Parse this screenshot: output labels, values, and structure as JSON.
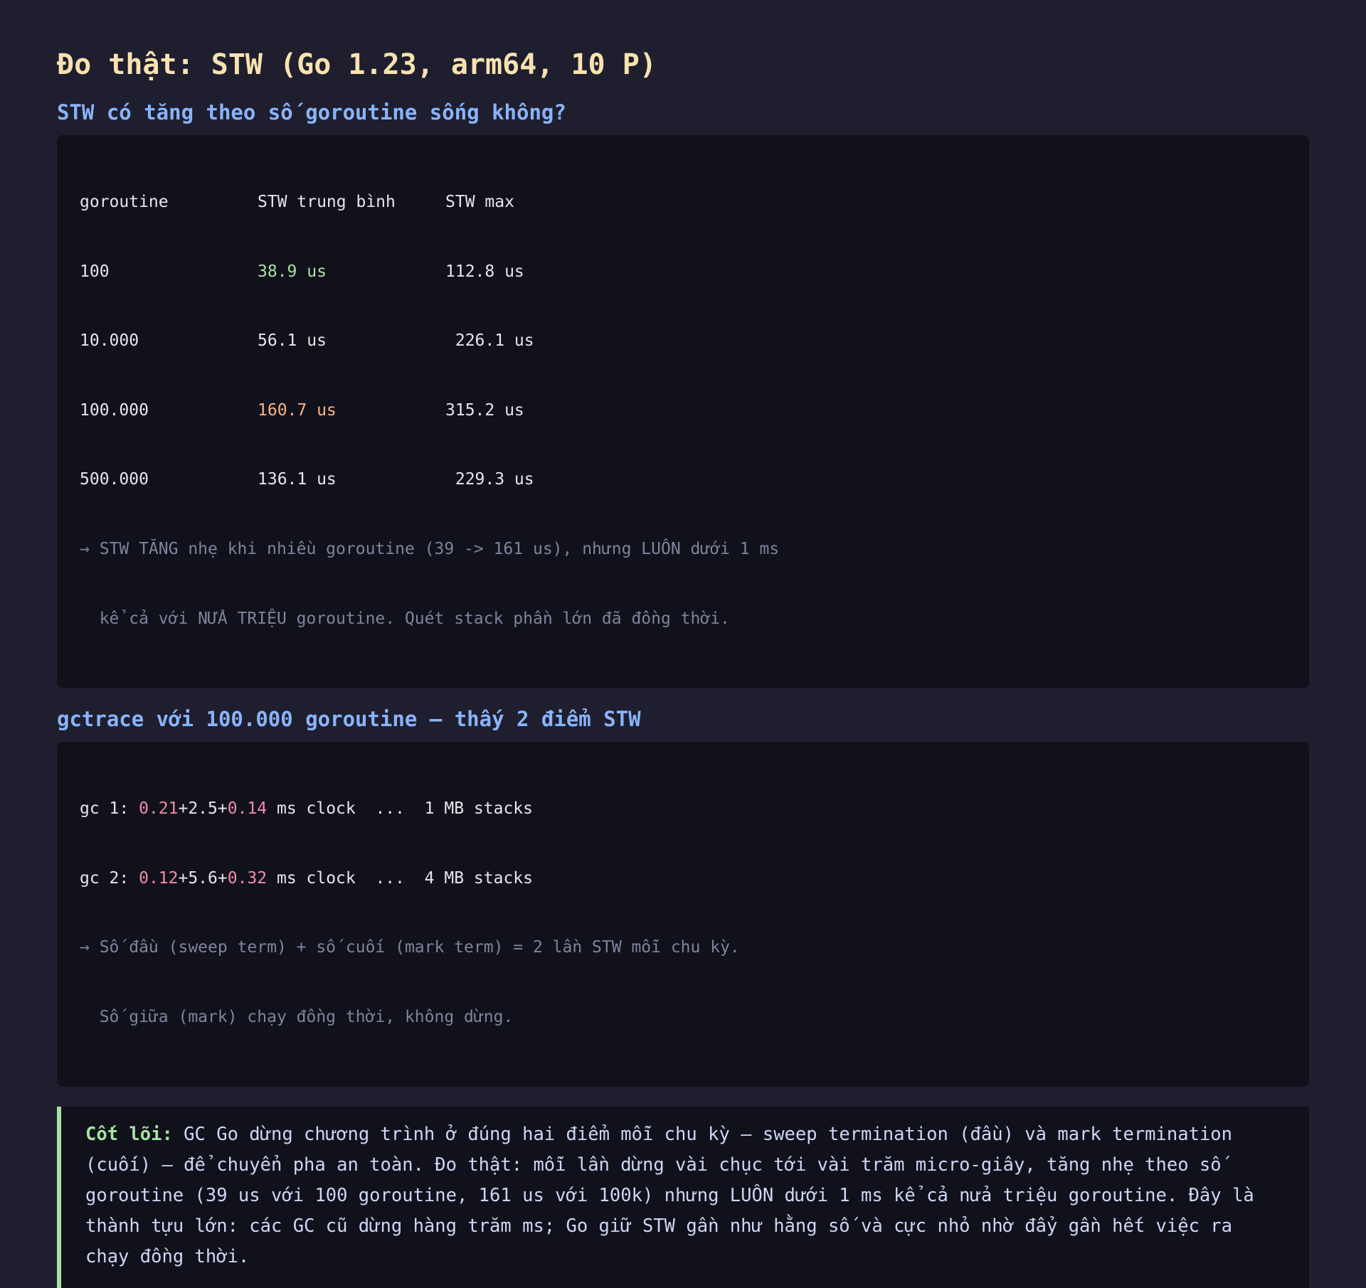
{
  "title": "Đo thật: STW (Go 1.23, arm64, 10 P)",
  "section1": {
    "heading": "STW có tăng theo số goroutine sống không?",
    "table": {
      "headers": [
        "goroutine",
        "STW trung bình",
        "STW max"
      ],
      "rows": [
        {
          "goroutines": "100",
          "avg": "38.9 us",
          "max": "112.8 us"
        },
        {
          "goroutines": "10.000",
          "avg": "56.1 us",
          "max": " 226.1 us"
        },
        {
          "goroutines": "100.000",
          "avg": "160.7 us",
          "max": "315.2 us"
        },
        {
          "goroutines": "500.000",
          "avg": "136.1 us",
          "max": " 229.3 us"
        }
      ]
    },
    "note_lines": [
      "→ STW TĂNG nhẹ khi nhiều goroutine (39 -> 161 us), nhưng LUÔN dưới 1 ms",
      "  kể cả với NỬA TRIỆU goroutine. Quét stack phần lớn đã đồng thời."
    ]
  },
  "section2": {
    "heading": "gctrace với 100.000 goroutine — thấy 2 điểm STW",
    "traces": [
      {
        "prefix": "gc 1: ",
        "stw1": "0.21",
        "mid": "+2.5+",
        "stw2": "0.14",
        "suffix": " ms clock  ...  1 MB stacks"
      },
      {
        "prefix": "gc 2: ",
        "stw1": "0.12",
        "mid": "+5.6+",
        "stw2": "0.32",
        "suffix": " ms clock  ...  4 MB stacks"
      }
    ],
    "note_lines": [
      "→ Số đầu (sweep term) + số cuối (mark term) = 2 lần STW mỗi chu kỳ.",
      "  Số giữa (mark) chạy đồng thời, không dừng."
    ]
  },
  "callout": {
    "lead": "Cốt lõi:",
    "text": " GC Go dừng chương trình ở đúng hai điểm mỗi chu kỳ — sweep termination (đầu) và mark termination (cuối) — để chuyển pha an toàn. Đo thật: mỗi lần dừng vài chục tới vài trăm micro-giây, tăng nhẹ theo số goroutine (39 us với 100 goroutine, 161 us với 100k) nhưng LUÔN dưới 1 ms kể cả nửa triệu goroutine. Đây là thành tựu lớn: các GC cũ dừng hàng trăm ms; Go giữ STW gần như hằng số và cực nhỏ nhờ đẩy gần hết việc ra chạy đồng thời."
  },
  "colors": {
    "background": "#1e1e2e",
    "panel": "#11111b",
    "title": "#f9e2af",
    "heading": "#89b4fa",
    "green": "#a6e3a1",
    "orange": "#fab387",
    "pink": "#f38ba8",
    "muted": "#7f849c"
  }
}
